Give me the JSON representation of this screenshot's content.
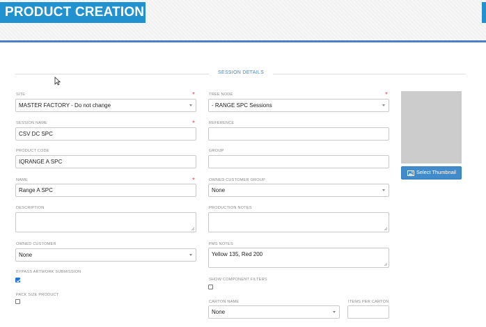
{
  "header": {
    "title": "PRODUCT CREATION",
    "accent_color": "#2191cf"
  },
  "section": {
    "title": "SESSION DETAILS"
  },
  "form": {
    "site": {
      "label": "SITE",
      "value": "MASTER FACTORY - Do not change",
      "required": true
    },
    "tree_node": {
      "label": "TREE NODE",
      "value": "- RANGE SPC Sessions",
      "required": true
    },
    "session_name": {
      "label": "SESSION NAME",
      "value": "CSV DC SPC",
      "required": true
    },
    "reference": {
      "label": "REFERENCE",
      "value": ""
    },
    "product_code": {
      "label": "PRODUCT CODE",
      "value": "IQRANGE A SPC"
    },
    "group": {
      "label": "GROUP",
      "value": ""
    },
    "name": {
      "label": "NAME",
      "value": "Range A SPC",
      "required": true
    },
    "owned_customer_group": {
      "label": "OWNED CUSTOMER GROUP",
      "value": "None"
    },
    "description": {
      "label": "DESCRIPTION",
      "value": ""
    },
    "production_notes": {
      "label": "PRODUCTION NOTES",
      "value": ""
    },
    "owned_customer": {
      "label": "OWNED CUSTOMER",
      "value": "None"
    },
    "pms_notes": {
      "label": "PMS NOTES",
      "value": "Yellow 135, Red 200"
    },
    "bypass_artwork": {
      "label": "BYPASS ARTWORK SUBMISSION",
      "checked": true
    },
    "show_component_filters": {
      "label": "SHOW COMPONENT FILTERS",
      "checked": false
    },
    "pack_size_product": {
      "label": "PACK SIZE PRODUCT",
      "checked": false
    },
    "carton_name": {
      "label": "CARTON NAME",
      "value": "None"
    },
    "items_per_carton": {
      "label": "ITEMS PER CARTON",
      "value": ""
    }
  },
  "thumbnail": {
    "button_label": "Select Thumbnail",
    "button_icon": "image-icon"
  }
}
